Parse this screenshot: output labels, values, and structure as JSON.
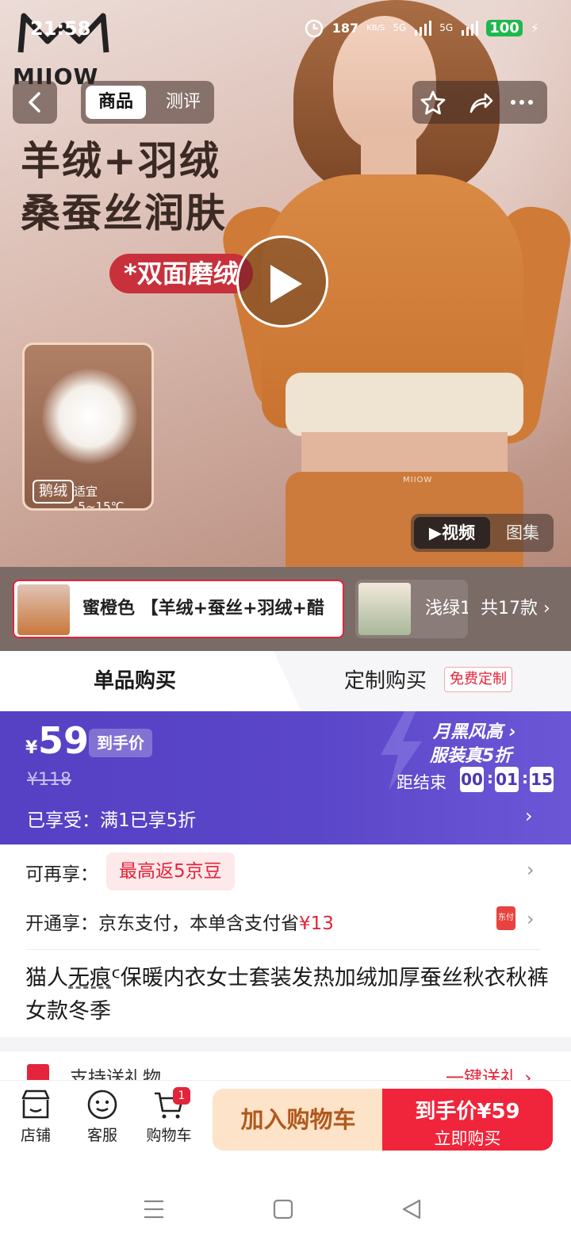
{
  "status": {
    "time": "21:58",
    "speed": "187",
    "speed_unit": "KB/S",
    "net1": "5G",
    "net2": "5G",
    "battery": "100"
  },
  "hero": {
    "brand": "MIIOW",
    "headline_1": "羊绒+羽绒",
    "headline_2": "桑蚕丝润肤",
    "tag": "*双面磨绒",
    "down_badge": "鹅绒",
    "down_note": "适宜 -5~15℃",
    "pants_logo": "MIIOW"
  },
  "top_tabs": {
    "active": "商品",
    "other": "测评"
  },
  "media_tabs": {
    "active": "▶视频",
    "other": "图集"
  },
  "variants": {
    "selected": "蜜橙色 【羊绒+蚕丝+羽绒+醋",
    "second": "浅绿1",
    "count": "共17款 ›"
  },
  "buy_mode": {
    "single": "单品购买",
    "custom": "定制购买",
    "custom_badge": "免费定制"
  },
  "price": {
    "yen": "¥",
    "value": "59",
    "tag": "到手价",
    "original": "¥118",
    "enjoy": "已享受：满1已享5折",
    "promo_line1": "月黑风高 ›",
    "promo_line2": "服装真5折",
    "ends_label": "距结束",
    "cd_h": "00",
    "cd_m": "01",
    "cd_s": "15",
    "colors": {
      "banner": "#5640c4",
      "accent": "#e3243a"
    }
  },
  "info": {
    "row1_label": "可再享：",
    "row1_chip": "最高返5京豆",
    "row2_label": "开通享：京东支付，本单含支付省",
    "row2_amount": "¥13",
    "pay_icon_text": "东付",
    "title_pre": "猫人",
    "title_u": "无痕",
    "title_post": "ᑦ保暖内衣女士套装发热加绒加厚蚕丝秋衣秋裤女款冬季"
  },
  "gift": {
    "text": "支持送礼物",
    "link": "一键送礼 ›"
  },
  "bottom": {
    "shop": "店铺",
    "service": "客服",
    "cart": "购物车",
    "cart_count": "1",
    "add_cart": "加入购物车",
    "buy_line1": "到手价¥59",
    "buy_line2": "立即购买"
  }
}
